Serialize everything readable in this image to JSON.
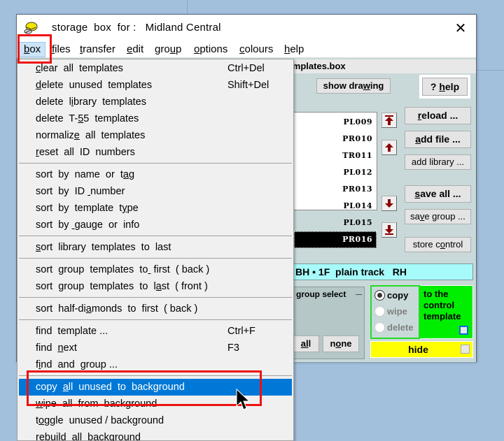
{
  "window": {
    "title": "storage  box  for :   Midland Central",
    "close_icon": "close-icon"
  },
  "menubar": {
    "items": [
      {
        "label": "box",
        "accel": "b",
        "active": true
      },
      {
        "label": "files",
        "accel": "f"
      },
      {
        "label": "transfer",
        "accel": "t"
      },
      {
        "label": "edit",
        "accel": "e"
      },
      {
        "label": "group",
        "accel": "u"
      },
      {
        "label": "options",
        "accel": "o"
      },
      {
        "label": "colours",
        "accel": "c"
      },
      {
        "label": "help",
        "accel": "h"
      }
    ]
  },
  "filebar": {
    "text": "_templates.box"
  },
  "buttons": {
    "show_drawing": "show  drawing",
    "help": "? help",
    "reload": "reload ...",
    "add_file": "add  file ...",
    "add_library": "add library ...",
    "save_all": "save  all ...",
    "save_group": "save group ...",
    "store_control": "store control",
    "all": "all",
    "none": "none"
  },
  "template_list": {
    "items": [
      "PL009",
      "PR010",
      "TR011",
      "PL012",
      "PR013",
      "PL014",
      "PL015",
      "PR016"
    ],
    "selected": "PR016"
  },
  "info_bar": {
    "text": "BH • 1F  plain track   RH"
  },
  "group_select": {
    "label": "group select"
  },
  "radio": {
    "options": [
      {
        "label": "copy",
        "checked": true,
        "enabled": true
      },
      {
        "label": "wipe",
        "checked": false,
        "enabled": false
      },
      {
        "label": "delete",
        "checked": false,
        "enabled": false
      }
    ]
  },
  "control_panel": {
    "text_lines": [
      "to the",
      "control",
      "template"
    ],
    "checked": false
  },
  "hide_bar": {
    "label": "hide",
    "checked": false
  },
  "dropdown": {
    "items": [
      {
        "label": "clear  all  templates",
        "shortcut": "Ctrl+Del"
      },
      {
        "label": "delete  unused  templates",
        "shortcut": "Shift+Del"
      },
      {
        "label": "delete  library  templates"
      },
      {
        "label": "delete  T-55  templates"
      },
      {
        "label": "normalize  all  templates"
      },
      {
        "label": "reset  all  ID  numbers"
      },
      {
        "label": "sort  by  name  or  tag"
      },
      {
        "label": "sort  by  ID  number"
      },
      {
        "label": "sort  by  template  type"
      },
      {
        "label": "sort  by  gauge  or  info"
      },
      {
        "label": "sort  library  templates  to  last"
      },
      {
        "label": "sort  group  templates  to  first  ( back )"
      },
      {
        "label": "sort  group  templates  to  last  ( front )"
      },
      {
        "label": "sort  half-diamonds  to  first  ( back )"
      },
      {
        "label": "find  template ...",
        "shortcut": "Ctrl+F"
      },
      {
        "label": "find  next",
        "shortcut": "F3"
      },
      {
        "label": "find  and  group ..."
      },
      {
        "label": "copy  all  unused  to  background",
        "highlighted": true
      },
      {
        "label": "wipe  all  from  background"
      },
      {
        "label": "toggle  unused / background"
      },
      {
        "label": "rebuild  all  background"
      }
    ]
  },
  "colors": {
    "desktop": "#a2bfdc",
    "client": "#c9d9d9",
    "highlight": "#0078d7",
    "info_bar": "#a7fafa",
    "green_panel": "#00ee00",
    "hide_bar": "#ffff00",
    "annotation": "#ee1111",
    "arrow": "#8b0000"
  }
}
